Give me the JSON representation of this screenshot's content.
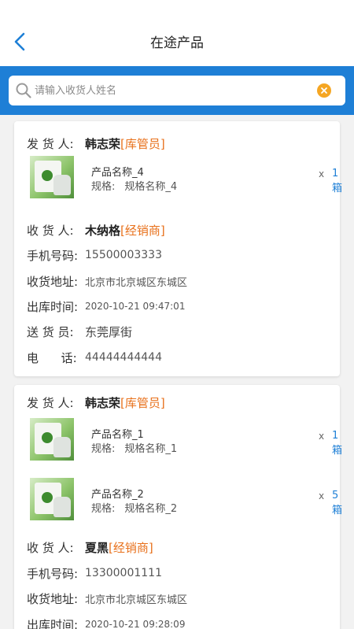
{
  "header": {
    "title": "在途产品"
  },
  "search": {
    "placeholder": "请输入收货人姓名"
  },
  "labels": {
    "sender": "发 货 人:",
    "receiver": "收 货 人:",
    "phone": "手机号码:",
    "address": "收货地址:",
    "out_time": "出库时间:",
    "courier": "送 货 员:",
    "tel": "电      话:",
    "spec": "规格:",
    "times": "x"
  },
  "cards": [
    {
      "sender_name": "韩志荣",
      "sender_role": "[库管员]",
      "products": [
        {
          "name": "产品名称_4",
          "spec": "规格名称_4",
          "qty": "1箱"
        }
      ],
      "receiver_name": "木纳格",
      "receiver_role": "[经销商]",
      "phone": "15500003333",
      "address": "北京市北京城区东城区",
      "out_time": "2020-10-21 09:47:01",
      "courier": "东莞厚街",
      "tel": "44444444444"
    },
    {
      "sender_name": "韩志荣",
      "sender_role": "[库管员]",
      "products": [
        {
          "name": "产品名称_1",
          "spec": "规格名称_1",
          "qty": "1箱"
        },
        {
          "name": "产品名称_2",
          "spec": "规格名称_2",
          "qty": "5箱"
        }
      ],
      "receiver_name": "夏黑",
      "receiver_role": "[经销商]",
      "phone": "13300001111",
      "address": "北京市北京城区东城区",
      "out_time": "2020-10-21 09:28:09"
    }
  ],
  "colors": {
    "accent": "#1e7fd6",
    "role": "#e8711c",
    "clear": "#f5a623"
  }
}
